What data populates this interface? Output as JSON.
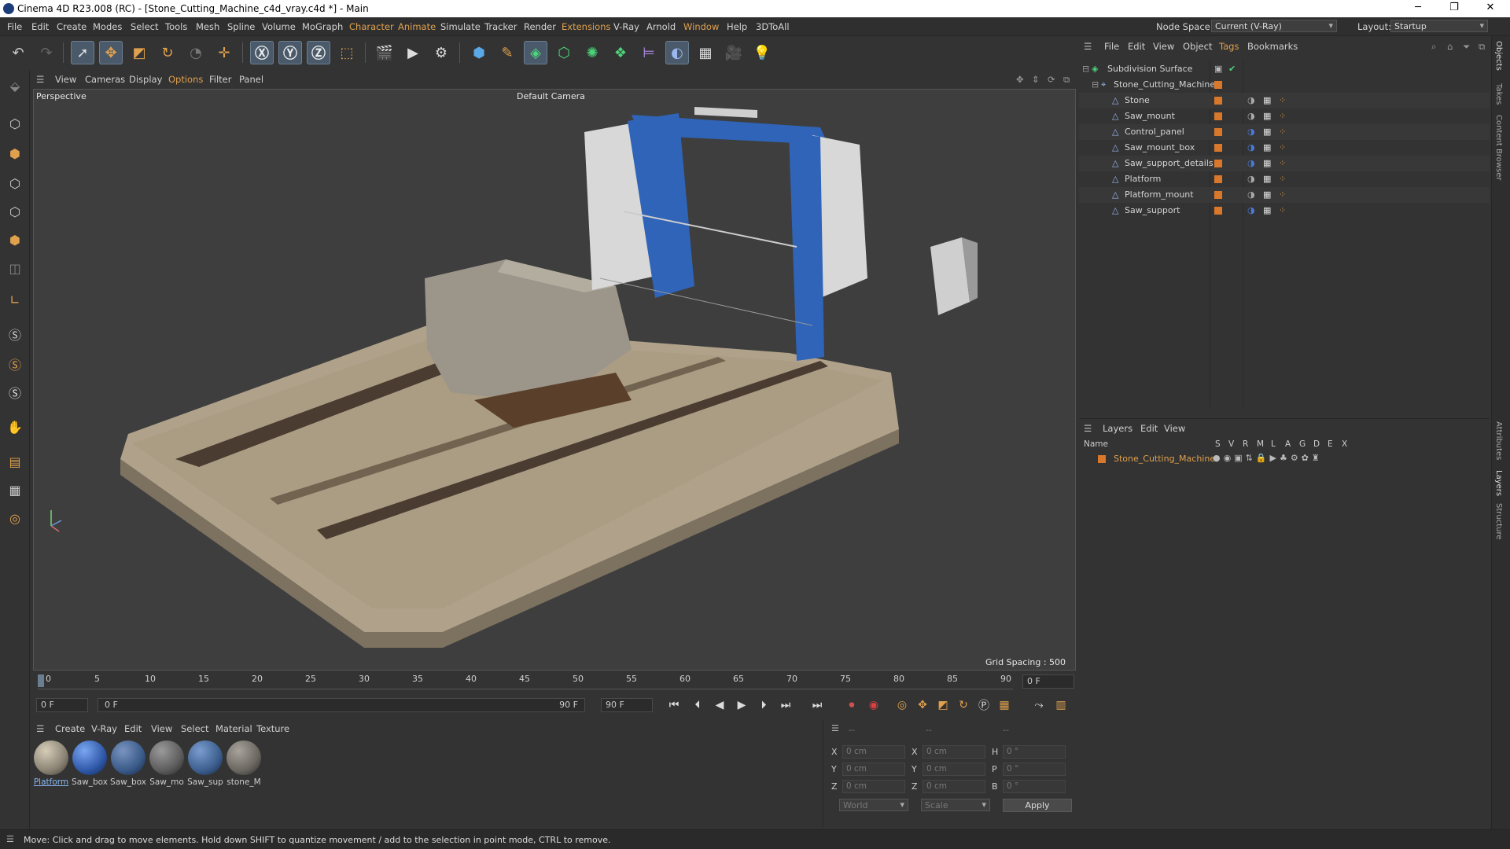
{
  "window": {
    "title": "Cinema 4D R23.008 (RC) - [Stone_Cutting_Machine_c4d_vray.c4d *] - Main"
  },
  "menubar": {
    "items": [
      "File",
      "Edit",
      "Create",
      "Modes",
      "Select",
      "Tools",
      "Mesh",
      "Spline",
      "Volume",
      "MoGraph",
      "Character",
      "Animate",
      "Simulate",
      "Tracker",
      "Render",
      "Extensions",
      "V-Ray",
      "Arnold",
      "Window",
      "Help",
      "3DToAll"
    ],
    "node_space_label": "Node Space:",
    "node_space_value": "Current (V-Ray)",
    "layout_label": "Layout:",
    "layout_value": "Startup"
  },
  "viewport": {
    "menu": [
      "View",
      "Cameras",
      "Display",
      "Options",
      "Filter",
      "Panel"
    ],
    "view_name": "Perspective",
    "camera": "Default Camera",
    "grid_spacing": "Grid Spacing : 500 cm"
  },
  "timeline": {
    "ticks": [
      "0",
      "5",
      "10",
      "15",
      "20",
      "25",
      "30",
      "35",
      "40",
      "45",
      "50",
      "55",
      "60",
      "65",
      "70",
      "75",
      "80",
      "85",
      "90"
    ],
    "current_frame": "0 F",
    "start_field": "0 F",
    "min_field": "0 F",
    "max_field": "90 F",
    "end_field": "90 F"
  },
  "material_manager": {
    "menu": [
      "Create",
      "V-Ray",
      "Edit",
      "View",
      "Select",
      "Material",
      "Texture"
    ],
    "materials": [
      {
        "name": "Platform",
        "color": "#8a8374"
      },
      {
        "name": "Saw_box",
        "color": "#2f58a8"
      },
      {
        "name": "Saw_box",
        "color": "#3a5a88"
      },
      {
        "name": "Saw_mo",
        "color": "#5c5c5c"
      },
      {
        "name": "Saw_sup",
        "color": "#3d5f8e"
      },
      {
        "name": "stone_M",
        "color": "#6a6660"
      }
    ]
  },
  "coordinates": {
    "rows": [
      {
        "a": "X",
        "av": "0 cm",
        "b": "X",
        "bv": "0 cm",
        "c": "H",
        "cv": "0 °"
      },
      {
        "a": "Y",
        "av": "0 cm",
        "b": "Y",
        "bv": "0 cm",
        "c": "P",
        "cv": "0 °"
      },
      {
        "a": "Z",
        "av": "0 cm",
        "b": "Z",
        "bv": "0 cm",
        "c": "B",
        "cv": "0 °"
      }
    ],
    "dashes": [
      "--",
      "--",
      "--"
    ],
    "space": "World",
    "mode": "Scale",
    "apply": "Apply"
  },
  "object_manager": {
    "menu": [
      "File",
      "Edit",
      "View",
      "Object",
      "Tags",
      "Bookmarks"
    ],
    "objects": [
      {
        "name": "Subdivision Surface",
        "level": 0
      },
      {
        "name": "Stone_Cutting_Machine",
        "level": 1
      },
      {
        "name": "Stone",
        "level": 2
      },
      {
        "name": "Saw_mount",
        "level": 2
      },
      {
        "name": "Control_panel",
        "level": 2
      },
      {
        "name": "Saw_mount_box",
        "level": 2
      },
      {
        "name": "Saw_support_details",
        "level": 2
      },
      {
        "name": "Platform",
        "level": 2
      },
      {
        "name": "Platform_mount",
        "level": 2
      },
      {
        "name": "Saw_support",
        "level": 2
      }
    ]
  },
  "layer_manager": {
    "menu": [
      "Layers",
      "Edit",
      "View"
    ],
    "header_name": "Name",
    "columns": [
      "S",
      "V",
      "R",
      "M",
      "L",
      "A",
      "G",
      "D",
      "E",
      "X"
    ],
    "layer": "Stone_Cutting_Machine"
  },
  "right_tabs": [
    "Objects",
    "Takes",
    "Content Browser",
    "Attributes",
    "Layers",
    "Structure"
  ],
  "status": "Move: Click and drag to move elements. Hold down SHIFT to quantize movement / add to the selection in point mode, CTRL to remove.",
  "colors": {
    "accent_orange": "#e0a14e",
    "layer_orange": "#d9772b",
    "select_blue": "#4a5a6a"
  }
}
